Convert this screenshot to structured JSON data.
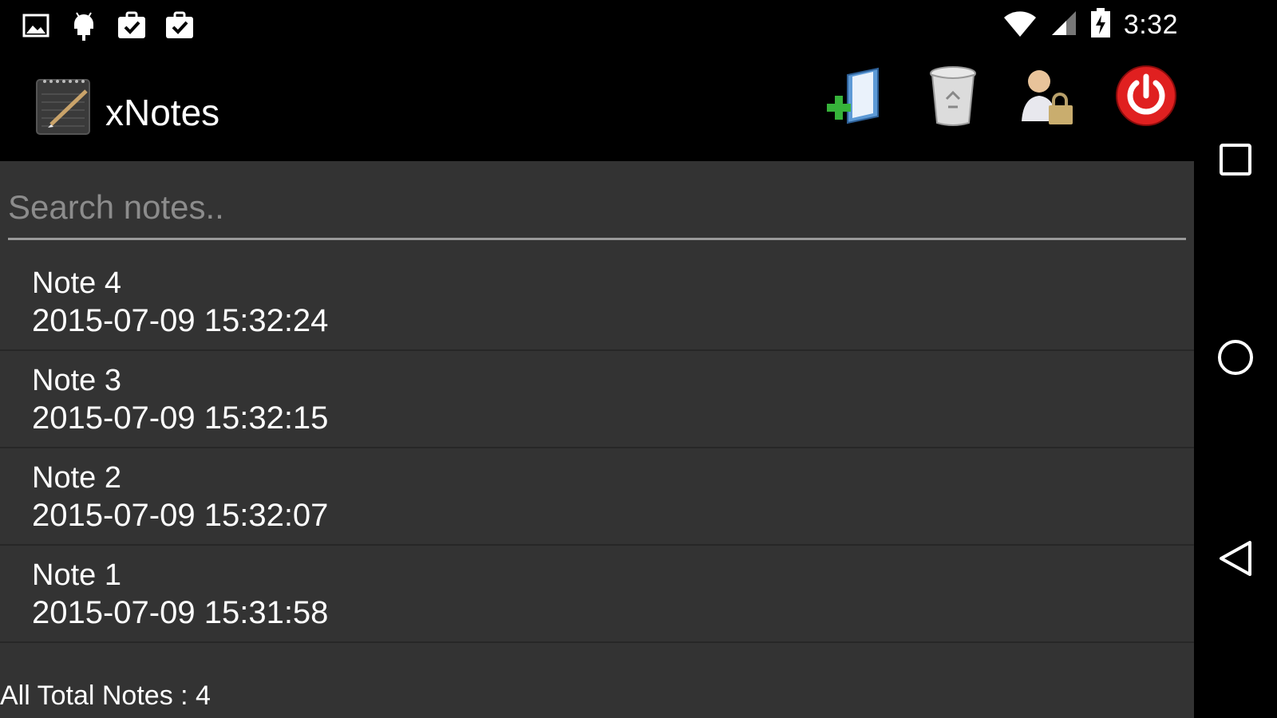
{
  "status_bar": {
    "time": "3:32",
    "icons": [
      "image-icon",
      "android-debug-icon",
      "clipboard-check-icon",
      "clipboard-check-icon",
      "wifi-icon",
      "signal-icon",
      "battery-charging-icon"
    ]
  },
  "action_bar": {
    "title": "xNotes",
    "app_icon": "notepad-icon",
    "actions": [
      "add-note-icon",
      "trash-icon",
      "user-lock-icon",
      "power-icon"
    ]
  },
  "search": {
    "placeholder": "Search notes..",
    "value": ""
  },
  "notes": [
    {
      "title": "Note 4",
      "date": "2015-07-09 15:32:24"
    },
    {
      "title": "Note 3",
      "date": "2015-07-09 15:32:15"
    },
    {
      "title": "Note 2",
      "date": "2015-07-09 15:32:07"
    },
    {
      "title": "Note 1",
      "date": "2015-07-09 15:31:58"
    }
  ],
  "footer": {
    "total_label": "All Total Notes : 4"
  },
  "nav_bar": {
    "buttons": [
      "recents-icon",
      "home-icon",
      "back-icon"
    ]
  },
  "colors": {
    "content_bg": "#333333",
    "bar_bg": "#000000",
    "power_red": "#e02020"
  }
}
